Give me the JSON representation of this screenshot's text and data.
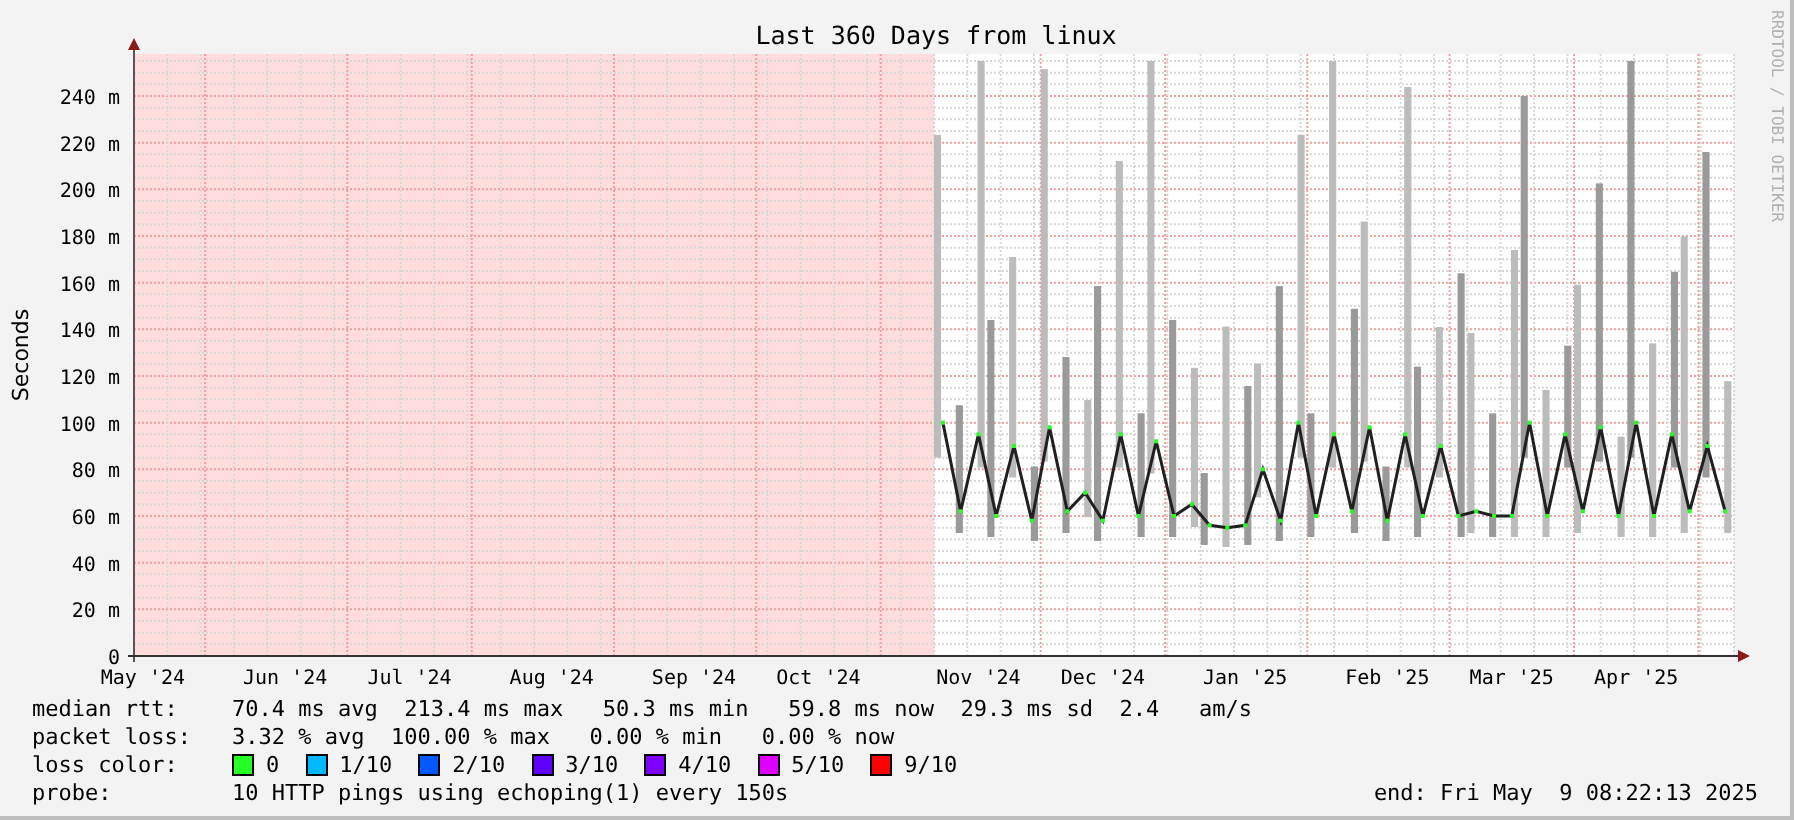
{
  "chart_data": {
    "type": "line",
    "grid": true,
    "title": "Last 360 Days from linux",
    "ylabel": "Seconds",
    "ylim": [
      0,
      258
    ],
    "yticks": [
      {
        "value": 0,
        "label": "0"
      },
      {
        "value": 20,
        "label": "20 m"
      },
      {
        "value": 40,
        "label": "40 m"
      },
      {
        "value": 60,
        "label": "60 m"
      },
      {
        "value": 80,
        "label": "80 m"
      },
      {
        "value": 100,
        "label": "100 m"
      },
      {
        "value": 120,
        "label": "120 m"
      },
      {
        "value": 140,
        "label": "140 m"
      },
      {
        "value": 160,
        "label": "160 m"
      },
      {
        "value": 180,
        "label": "180 m"
      },
      {
        "value": 200,
        "label": "200 m"
      },
      {
        "value": 220,
        "label": "220 m"
      },
      {
        "value": 240,
        "label": "240 m"
      }
    ],
    "categories": [
      "May '24",
      null,
      null,
      null,
      null,
      null,
      null,
      null,
      "Jun '24",
      null,
      null,
      null,
      null,
      null,
      null,
      "Jul '24",
      null,
      null,
      null,
      null,
      null,
      null,
      null,
      "Aug '24",
      null,
      null,
      null,
      null,
      null,
      null,
      null,
      "Sep '24",
      null,
      null,
      null,
      null,
      null,
      null,
      "Oct '24",
      null,
      null,
      null,
      null,
      null,
      null,
      null,
      null,
      "Nov '24",
      null,
      null,
      null,
      null,
      null,
      null,
      "Dec '24",
      null,
      null,
      null,
      null,
      null,
      null,
      null,
      "Jan '25",
      null,
      null,
      null,
      null,
      null,
      null,
      null,
      "Feb '25",
      null,
      null,
      null,
      null,
      null,
      null,
      "Mar '25",
      null,
      null,
      null,
      null,
      null,
      null,
      "Apr '25",
      null,
      null,
      null,
      null,
      null
    ],
    "series": [
      {
        "color": "#202020",
        "marker": "square",
        "values": [
          null,
          null,
          null,
          null,
          null,
          null,
          null,
          null,
          null,
          null,
          null,
          null,
          null,
          null,
          null,
          null,
          null,
          null,
          null,
          null,
          null,
          null,
          null,
          null,
          null,
          null,
          null,
          null,
          null,
          null,
          null,
          null,
          null,
          null,
          null,
          null,
          null,
          null,
          null,
          null,
          null,
          null,
          null,
          null,
          null,
          100,
          62,
          95,
          60,
          90,
          58,
          98,
          62,
          70,
          58,
          95,
          60,
          92,
          60,
          65,
          56,
          55,
          56,
          80,
          58,
          100,
          60,
          95,
          62,
          98,
          58,
          95,
          60,
          90,
          60,
          62,
          60,
          60,
          100,
          60,
          95,
          62,
          98,
          60,
          100,
          60,
          95,
          62,
          90,
          62
        ]
      }
    ]
  },
  "credit": "RRDTOOL / TOBI OETIKER",
  "stats": [
    {
      "label": "median rtt:",
      "text": "70.4 ms avg  213.4 ms max   50.3 ms min   59.8 ms now  29.3 ms sd  2.4   am/s"
    },
    {
      "label": "packet loss:",
      "text": "3.32 % avg  100.00 % max   0.00 % min   0.00 % now"
    }
  ],
  "loss_color": {
    "label": "loss color:",
    "items": [
      {
        "text": "0",
        "color": "#26ff26"
      },
      {
        "text": "1/10",
        "color": "#00b8ff"
      },
      {
        "text": "2/10",
        "color": "#0059ff"
      },
      {
        "text": "3/10",
        "color": "#5e00ff"
      },
      {
        "text": "4/10",
        "color": "#7e00ff"
      },
      {
        "text": "5/10",
        "color": "#dd00ff"
      },
      {
        "text": "9/10",
        "color": "#ff0000"
      }
    ]
  },
  "probe": {
    "label": "probe:",
    "text": "10 HTTP pings using echoping(1) every 150s",
    "end": "end: Fri May  9 08:22:13 2025"
  }
}
